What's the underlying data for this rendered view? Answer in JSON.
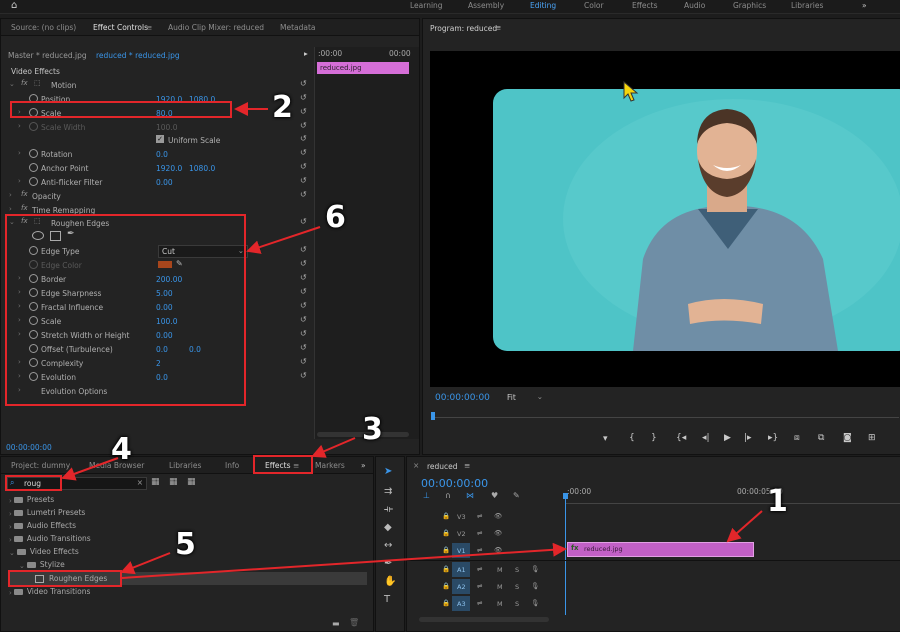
{
  "workspaces": {
    "items": [
      "Learning",
      "Assembly",
      "Editing",
      "Color",
      "Effects",
      "Audio",
      "Graphics",
      "Libraries"
    ],
    "active": "Editing",
    "more": "»"
  },
  "source_panel": {
    "tabs": [
      "Source: (no clips)",
      "Effect Controls",
      "Audio Clip Mixer: reduced",
      "Metadata"
    ],
    "active_tab": "Effect Controls",
    "master_label": "Master * reduced.jpg",
    "clip_label": "reduced * reduced.jpg",
    "timeline_start": ":00:00",
    "timeline_end": "00:00",
    "clip_bar_label": "reduced.jpg",
    "section_label": "Video Effects",
    "motion": {
      "name": "Motion",
      "position": {
        "label": "Position",
        "x": "1920.0",
        "y": "1080.0"
      },
      "scale": {
        "label": "Scale",
        "value": "80.0"
      },
      "scale_width": {
        "label": "Scale Width",
        "value": "100.0"
      },
      "uniform_scale": "Uniform Scale",
      "rotation": {
        "label": "Rotation",
        "value": "0.0"
      },
      "anchor": {
        "label": "Anchor Point",
        "x": "1920.0",
        "y": "1080.0"
      },
      "antiflicker": {
        "label": "Anti-flicker Filter",
        "value": "0.00"
      }
    },
    "opacity": "Opacity",
    "time_remapping": "Time Remapping",
    "roughen": {
      "name": "Roughen Edges",
      "edge_type": {
        "label": "Edge Type",
        "value": "Cut"
      },
      "edge_color": {
        "label": "Edge Color",
        "swatch": "#a8461c"
      },
      "border": {
        "label": "Border",
        "value": "200.00"
      },
      "sharpness": {
        "label": "Edge Sharpness",
        "value": "5.00"
      },
      "fractal": {
        "label": "Fractal Influence",
        "value": "0.00"
      },
      "scale": {
        "label": "Scale",
        "value": "100.0"
      },
      "stretch": {
        "label": "Stretch Width or Height",
        "value": "0.00"
      },
      "offset": {
        "label": "Offset (Turbulence)",
        "x": "0.0",
        "y": "0.0"
      },
      "complexity": {
        "label": "Complexity",
        "value": "2"
      },
      "evolution": {
        "label": "Evolution",
        "value": "0.0"
      },
      "evolution_options": "Evolution Options"
    },
    "timecode": "00:00:00:00"
  },
  "program_monitor": {
    "title": "Program: reduced",
    "timecode": "00:00:00:00",
    "fit": "Fit"
  },
  "project_panel": {
    "tabs": [
      "Project: dummy",
      "Media Browser",
      "Libraries",
      "Info",
      "Effects",
      "Markers"
    ],
    "active_tab": "Effects",
    "search_value": "roug",
    "tree": [
      "Presets",
      "Lumetri Presets",
      "Audio Effects",
      "Audio Transitions",
      "Video Effects",
      "Stylize",
      "Roughen Edges",
      "Video Transitions"
    ]
  },
  "timeline": {
    "tab": "reduced",
    "timecode": "00:00:00:00",
    "ruler_start": ":00:00",
    "ruler_mid": "00:00:05:00",
    "video_tracks": [
      "V3",
      "V2",
      "V1"
    ],
    "audio_tracks": [
      "A1",
      "A2",
      "A3"
    ],
    "clip_label": "reduced.jpg",
    "track_letters": {
      "m": "M",
      "s": "S"
    }
  },
  "annotations": [
    "1",
    "2",
    "3",
    "4",
    "5",
    "6"
  ]
}
